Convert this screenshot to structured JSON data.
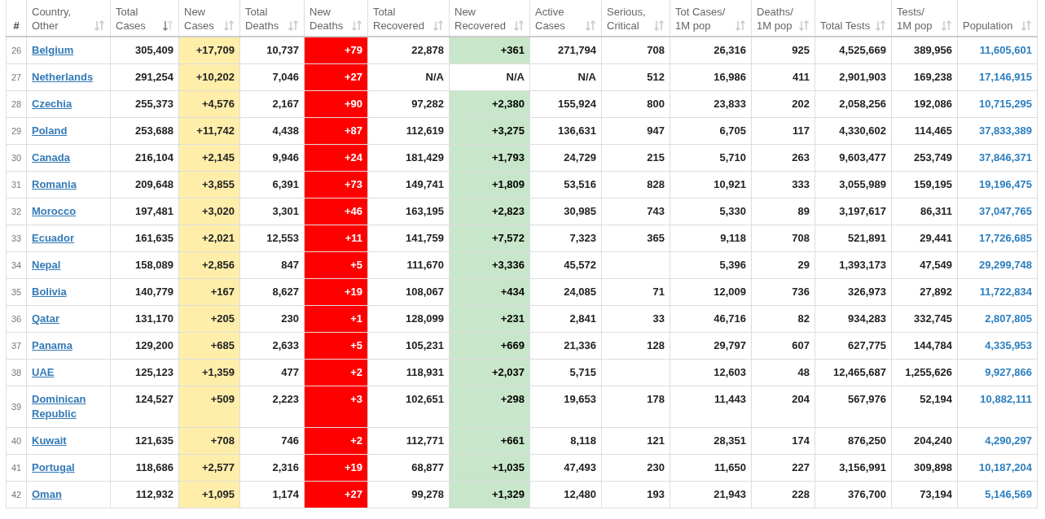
{
  "table": {
    "columns": [
      {
        "label": "#",
        "kind": "rank"
      },
      {
        "label": "Country, Other",
        "kind": "country",
        "sorted": false
      },
      {
        "label": "Total Cases",
        "kind": "number",
        "sorted": true
      },
      {
        "label": "New Cases",
        "kind": "new_cases",
        "sorted": false
      },
      {
        "label": "Total Deaths",
        "kind": "number",
        "sorted": false
      },
      {
        "label": "New Deaths",
        "kind": "new_deaths",
        "sorted": false
      },
      {
        "label": "Total Recovered",
        "kind": "number",
        "sorted": false
      },
      {
        "label": "New Recovered",
        "kind": "new_recovered",
        "sorted": false
      },
      {
        "label": "Active Cases",
        "kind": "number",
        "sorted": false
      },
      {
        "label": "Serious, Critical",
        "kind": "number",
        "sorted": false
      },
      {
        "label": "Tot Cases/ 1M pop",
        "kind": "number",
        "sorted": false
      },
      {
        "label": "Deaths/ 1M pop",
        "kind": "number",
        "sorted": false
      },
      {
        "label": "Total Tests",
        "kind": "number",
        "sorted": false
      },
      {
        "label": "Tests/ 1M pop",
        "kind": "number",
        "sorted": false
      },
      {
        "label": "Population",
        "kind": "population",
        "sorted": false
      }
    ],
    "rows": [
      {
        "new_recovered_highlighted": true,
        "cells": [
          "26",
          "Belgium",
          "305,409",
          "+17,709",
          "10,737",
          "+79",
          "22,878",
          "+361",
          "271,794",
          "708",
          "26,316",
          "925",
          "4,525,669",
          "389,956",
          "11,605,601"
        ]
      },
      {
        "new_recovered_highlighted": false,
        "cells": [
          "27",
          "Netherlands",
          "291,254",
          "+10,202",
          "7,046",
          "+27",
          "N/A",
          "N/A",
          "N/A",
          "512",
          "16,986",
          "411",
          "2,901,903",
          "169,238",
          "17,146,915"
        ]
      },
      {
        "new_recovered_highlighted": true,
        "cells": [
          "28",
          "Czechia",
          "255,373",
          "+4,576",
          "2,167",
          "+90",
          "97,282",
          "+2,380",
          "155,924",
          "800",
          "23,833",
          "202",
          "2,058,256",
          "192,086",
          "10,715,295"
        ]
      },
      {
        "new_recovered_highlighted": true,
        "cells": [
          "29",
          "Poland",
          "253,688",
          "+11,742",
          "4,438",
          "+87",
          "112,619",
          "+3,275",
          "136,631",
          "947",
          "6,705",
          "117",
          "4,330,602",
          "114,465",
          "37,833,389"
        ]
      },
      {
        "new_recovered_highlighted": true,
        "cells": [
          "30",
          "Canada",
          "216,104",
          "+2,145",
          "9,946",
          "+24",
          "181,429",
          "+1,793",
          "24,729",
          "215",
          "5,710",
          "263",
          "9,603,477",
          "253,749",
          "37,846,371"
        ]
      },
      {
        "new_recovered_highlighted": true,
        "cells": [
          "31",
          "Romania",
          "209,648",
          "+3,855",
          "6,391",
          "+73",
          "149,741",
          "+1,809",
          "53,516",
          "828",
          "10,921",
          "333",
          "3,055,989",
          "159,195",
          "19,196,475"
        ]
      },
      {
        "new_recovered_highlighted": true,
        "cells": [
          "32",
          "Morocco",
          "197,481",
          "+3,020",
          "3,301",
          "+46",
          "163,195",
          "+2,823",
          "30,985",
          "743",
          "5,330",
          "89",
          "3,197,617",
          "86,311",
          "37,047,765"
        ]
      },
      {
        "new_recovered_highlighted": true,
        "cells": [
          "33",
          "Ecuador",
          "161,635",
          "+2,021",
          "12,553",
          "+11",
          "141,759",
          "+7,572",
          "7,323",
          "365",
          "9,118",
          "708",
          "521,891",
          "29,441",
          "17,726,685"
        ]
      },
      {
        "new_recovered_highlighted": true,
        "cells": [
          "34",
          "Nepal",
          "158,089",
          "+2,856",
          "847",
          "+5",
          "111,670",
          "+3,336",
          "45,572",
          null,
          "5,396",
          "29",
          "1,393,173",
          "47,549",
          "29,299,748"
        ]
      },
      {
        "new_recovered_highlighted": true,
        "cells": [
          "35",
          "Bolivia",
          "140,779",
          "+167",
          "8,627",
          "+19",
          "108,067",
          "+434",
          "24,085",
          "71",
          "12,009",
          "736",
          "326,973",
          "27,892",
          "11,722,834"
        ]
      },
      {
        "new_recovered_highlighted": true,
        "cells": [
          "36",
          "Qatar",
          "131,170",
          "+205",
          "230",
          "+1",
          "128,099",
          "+231",
          "2,841",
          "33",
          "46,716",
          "82",
          "934,283",
          "332,745",
          "2,807,805"
        ]
      },
      {
        "new_recovered_highlighted": true,
        "cells": [
          "37",
          "Panama",
          "129,200",
          "+685",
          "2,633",
          "+5",
          "105,231",
          "+669",
          "21,336",
          "128",
          "29,797",
          "607",
          "627,775",
          "144,784",
          "4,335,953"
        ]
      },
      {
        "new_recovered_highlighted": true,
        "cells": [
          "38",
          "UAE",
          "125,123",
          "+1,359",
          "477",
          "+2",
          "118,931",
          "+2,037",
          "5,715",
          null,
          "12,603",
          "48",
          "12,465,687",
          "1,255,626",
          "9,927,866"
        ]
      },
      {
        "new_recovered_highlighted": true,
        "cells": [
          "39",
          "Dominican Republic",
          "124,527",
          "+509",
          "2,223",
          "+3",
          "102,651",
          "+298",
          "19,653",
          "178",
          "11,443",
          "204",
          "567,976",
          "52,194",
          "10,882,111"
        ]
      },
      {
        "new_recovered_highlighted": true,
        "cells": [
          "40",
          "Kuwait",
          "121,635",
          "+708",
          "746",
          "+2",
          "112,771",
          "+661",
          "8,118",
          "121",
          "28,351",
          "174",
          "876,250",
          "204,240",
          "4,290,297"
        ]
      },
      {
        "new_recovered_highlighted": true,
        "cells": [
          "41",
          "Portugal",
          "118,686",
          "+2,577",
          "2,316",
          "+19",
          "68,877",
          "+1,035",
          "47,493",
          "230",
          "11,650",
          "227",
          "3,156,991",
          "309,898",
          "10,187,204"
        ]
      },
      {
        "new_recovered_highlighted": true,
        "cells": [
          "42",
          "Oman",
          "112,932",
          "+1,095",
          "1,174",
          "+27",
          "99,278",
          "+1,329",
          "12,480",
          "193",
          "21,943",
          "228",
          "376,700",
          "73,194",
          "5,146,569"
        ]
      }
    ]
  }
}
